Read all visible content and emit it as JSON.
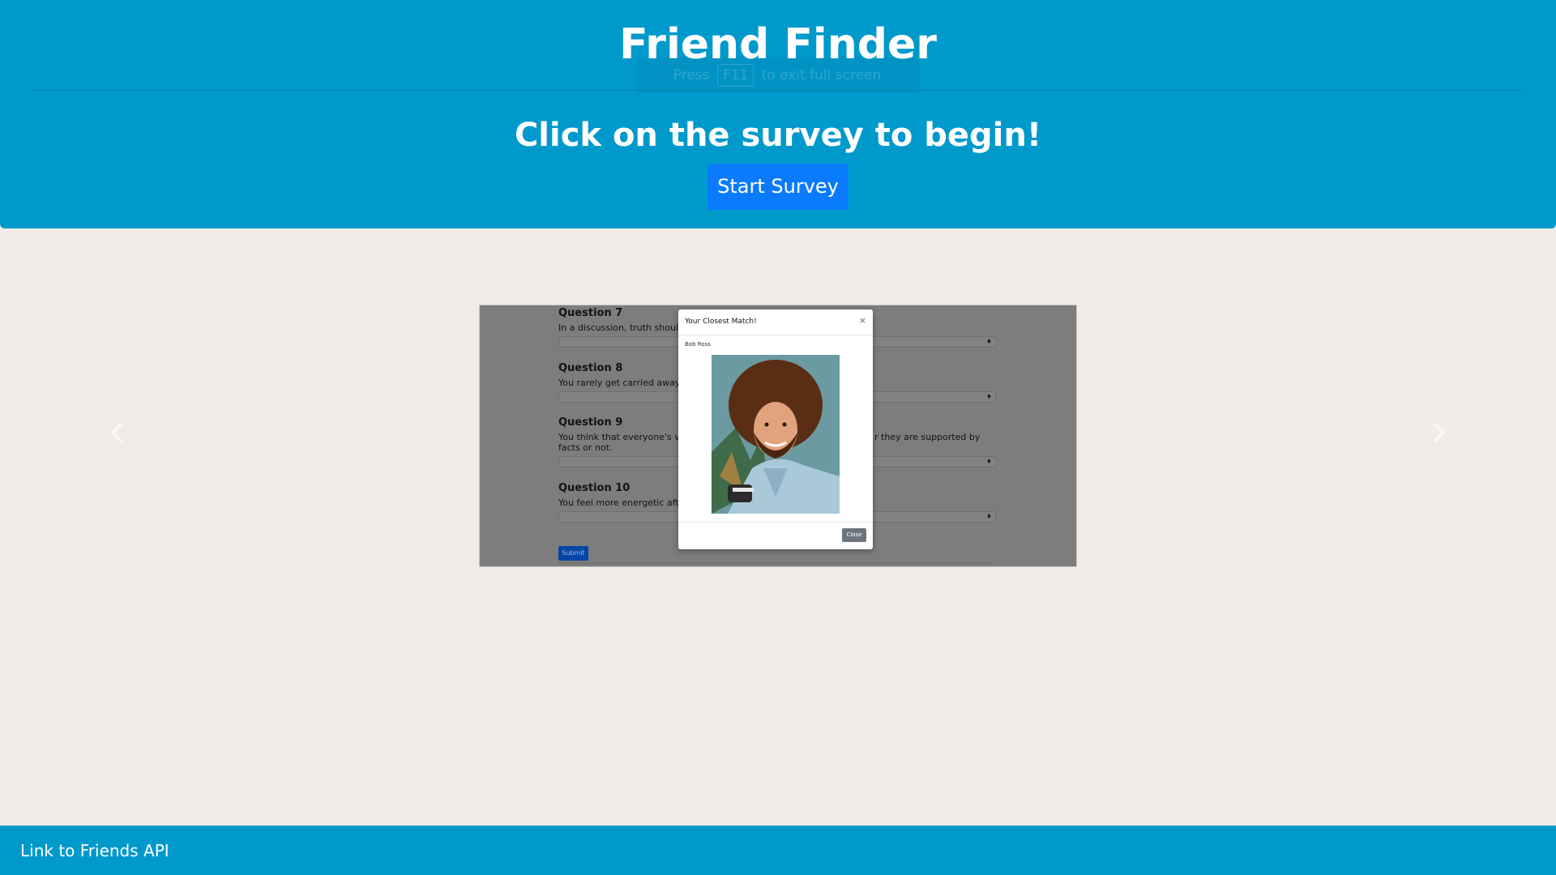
{
  "header": {
    "title": "Friend Finder",
    "fullscreen_hint": {
      "before": "Press",
      "key": "F11",
      "after": "to exit full screen"
    },
    "lead": "Click on the survey to begin!",
    "start_button": "Start Survey"
  },
  "carousel": {
    "prev_icon": "chevron-left-icon",
    "next_icon": "chevron-right-icon",
    "slide": {
      "questions": [
        {
          "title": "Question 7",
          "text": "In a discussion, truth should"
        },
        {
          "title": "Question 8",
          "text": "You rarely get carried away l"
        },
        {
          "title": "Question 9",
          "text_left": "You think that everyone's vi",
          "text_right": "r they are supported by",
          "text_line2": "facts or not."
        },
        {
          "title": "Question 10",
          "text": "You feel more energetic afte"
        }
      ],
      "submit_label": "Submit",
      "modal": {
        "title": "Your Closest Match!",
        "close_icon": "×",
        "match_name": "Bob Ross",
        "close_label": "Close"
      }
    }
  },
  "footer": {
    "link_label": "Link to Friends API"
  }
}
